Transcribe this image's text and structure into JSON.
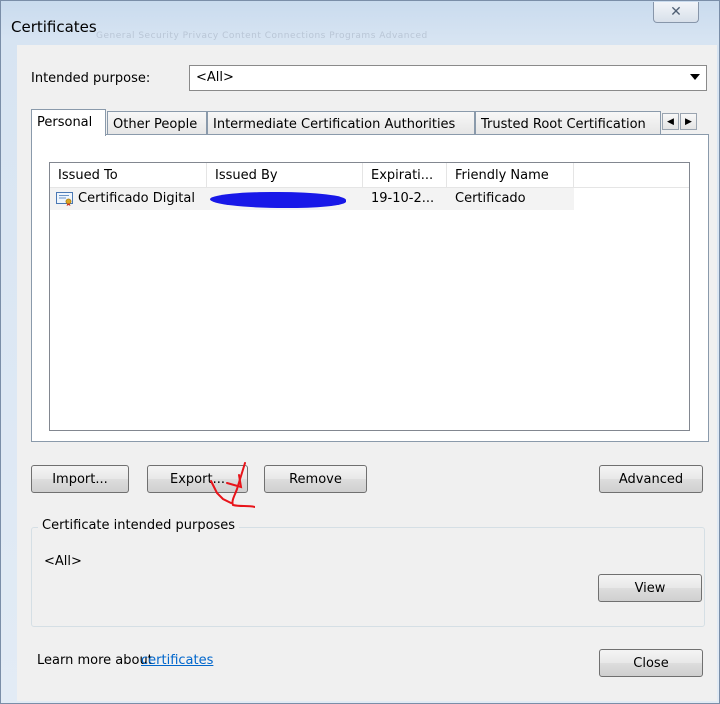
{
  "window": {
    "title": "Certificates",
    "ghost_tabs": "General   Security   Privacy   Content   Connections   Programs   Advanced"
  },
  "purpose": {
    "label": "Intended purpose:",
    "value": "<All>"
  },
  "tabs": [
    {
      "label": "Personal"
    },
    {
      "label": "Other People"
    },
    {
      "label": "Intermediate Certification Authorities"
    },
    {
      "label": "Trusted Root Certification"
    }
  ],
  "list": {
    "columns": [
      "Issued To",
      "Issued By",
      "Expirati...",
      "Friendly Name"
    ],
    "rows": [
      {
        "issued_to": "Certificado Digital",
        "issued_by": "",
        "expiration": "19-10-2...",
        "friendly_name": "Certificado"
      }
    ]
  },
  "buttons": {
    "import": "Import...",
    "export": "Export...",
    "remove": "Remove",
    "advanced": "Advanced",
    "view": "View",
    "close": "Close"
  },
  "purposes": {
    "title": "Certificate intended purposes",
    "value": "<All>"
  },
  "footer": {
    "learn_more": "Learn more about",
    "link": "certificates"
  },
  "colors": {
    "link": "#0066cc",
    "redaction": "#1818e8",
    "annotation": "#e8141a"
  },
  "icons": {
    "close": "close-icon",
    "certificate": "certificate-icon",
    "dropdown": "chevron-down-icon"
  }
}
